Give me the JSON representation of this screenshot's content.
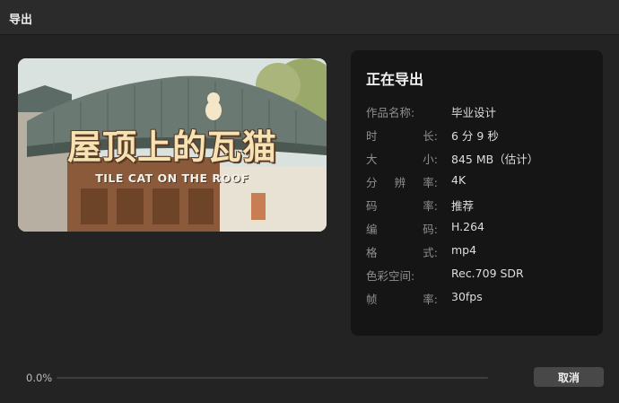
{
  "window": {
    "title": "导出"
  },
  "thumbnail": {
    "title_cn": "屋顶上的瓦猫",
    "title_en": "TILE CAT ON THE ROOF"
  },
  "info": {
    "heading": "正在导出",
    "rows": [
      {
        "key": "作品名称:",
        "value": "毕业设计"
      },
      {
        "key": "时 长:",
        "value": "6 分 9 秒"
      },
      {
        "key": "大 小:",
        "value": "845 MB（估计）"
      },
      {
        "key": "分 辨 率:",
        "value": "4K"
      },
      {
        "key": "码 率:",
        "value": "推荐"
      },
      {
        "key": "编 码:",
        "value": "H.264"
      },
      {
        "key": "格 式:",
        "value": "mp4"
      },
      {
        "key": "色彩空间:",
        "value": "Rec.709 SDR"
      },
      {
        "key": "帧 率:",
        "value": "30fps"
      }
    ]
  },
  "progress": {
    "text": "0.0%",
    "percent": 0
  },
  "actions": {
    "cancel_label": "取消"
  }
}
